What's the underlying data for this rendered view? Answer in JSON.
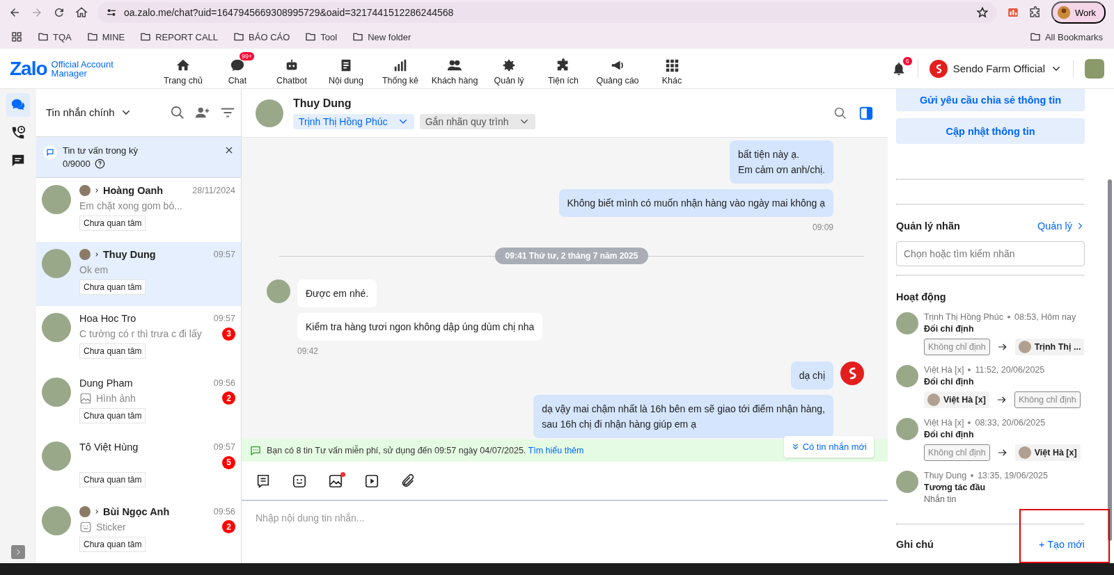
{
  "browser": {
    "url": "oa.zalo.me/chat?uid=1647945669308995729&oaid=3217441512286244568",
    "profile": "Work",
    "bookmarks": [
      "TQA",
      "MINE",
      "REPORT CALL",
      "BÁO CÁO",
      "Tool",
      "New folder"
    ],
    "all_bookmarks": "All Bookmarks"
  },
  "app": {
    "logo": "Zalo",
    "logo_sub": "Official Account Manager",
    "nav": [
      {
        "label": "Trang chủ"
      },
      {
        "label": "Chat",
        "badge": "99+"
      },
      {
        "label": "Chatbot"
      },
      {
        "label": "Nội dung"
      },
      {
        "label": "Thống kê"
      },
      {
        "label": "Khách hàng"
      },
      {
        "label": "Quản lý"
      },
      {
        "label": "Tiện ích"
      },
      {
        "label": "Quảng cáo"
      },
      {
        "label": "Khác"
      }
    ],
    "notifications": "6",
    "account": "Sendo Farm Official"
  },
  "rail": [
    {
      "selected": true
    },
    {
      "selected": false
    },
    {
      "selected": false
    }
  ],
  "list": {
    "filter": "Tin nhắn chính",
    "quota": {
      "title": "Tin tư vấn trong kỳ",
      "count": "0/9000"
    },
    "conversations": [
      {
        "kind": "text",
        "name": "Hoàng Oanh",
        "assigned": true,
        "time": "28/11/2024",
        "preview": "Em chặt xong gom bỏ...",
        "tag": "Chưa quan tâm",
        "selected": false
      },
      {
        "kind": "text",
        "name": "Thuy Dung",
        "assigned": true,
        "time": "09:57",
        "preview": "Ok em",
        "tag": "Chưa quan tâm",
        "selected": true
      },
      {
        "kind": "text",
        "name": "Hoa Hoc Tro",
        "assigned": false,
        "time": "09:57",
        "preview": "C tưởng có r thì trưa c đi lấy",
        "unread": "3",
        "tag": "Chưa quan tâm",
        "selected": false
      },
      {
        "kind": "image",
        "name": "Dung Pham",
        "assigned": false,
        "time": "09:56",
        "preview": "Hình ảnh",
        "unread": "2",
        "tag": "Chưa quan tâm",
        "selected": false
      },
      {
        "kind": "text",
        "name": "Tô Việt Hùng",
        "assigned": false,
        "time": "09:57",
        "unread": "5",
        "tag": "Chưa quan tâm",
        "selected": false
      },
      {
        "kind": "sticker",
        "name": "Bùi Ngọc Anh",
        "assigned": true,
        "time": "09:56",
        "preview": "Sticker",
        "unread": "2",
        "tag": "Chưa quan tâm",
        "selected": false
      }
    ]
  },
  "chat": {
    "name": "Thuy Dung",
    "assignee": "Trịnh Thị Hồng Phúc",
    "process_tag": "Gắn nhãn quy trình",
    "messages": [
      {
        "kind": "out",
        "lines": [
          "bất tiện này ạ.",
          "Em cảm ơn anh/chị."
        ],
        "avatar": false
      },
      {
        "kind": "out",
        "lines": [
          "Không biết mình có muốn nhận hàng vào ngày mai không ạ"
        ],
        "avatar": false
      },
      {
        "kind": "time_out",
        "text": "09:09"
      },
      {
        "kind": "divider",
        "text": "09:41 Thứ tư, 2 tháng 7 năm 2025"
      },
      {
        "kind": "in",
        "lines": [
          "Được em nhé."
        ],
        "avatar": true
      },
      {
        "kind": "in",
        "lines": [
          "Kiểm tra hàng tươi ngon không dập úng dùm chị nha"
        ],
        "avatar": false
      },
      {
        "kind": "time_in",
        "text": "09:42"
      },
      {
        "kind": "out",
        "lines": [
          "dạ chị"
        ],
        "avatar": true
      },
      {
        "kind": "out",
        "lines": [
          "dạ vậy mai chậm nhất là 16h bên em sẽ giao tới điểm nhận hàng,",
          "sau 16h chị đi nhận hàng giúp em ạ"
        ],
        "avatar": false
      }
    ],
    "new_messages": "Có tin nhắn mới",
    "notice": "Bạn có 8 tin Tư vấn miễn phí, sử dụng đến 09:57 ngày 04/07/2025.",
    "notice_link": "Tìm hiểu thêm",
    "input_placeholder": "Nhập nội dung tin nhắn..."
  },
  "panel": {
    "buttons": [
      "Gửi yêu cầu chia sẻ thông tin",
      "Cập nhật thông tin"
    ],
    "labels_title": "Quản lý nhãn",
    "labels_link": "Quản lý",
    "labels_placeholder": "Chọn hoặc tìm kiếm nhãn",
    "activity_title": "Hoạt động",
    "activities": [
      {
        "actor": "Trịnh Thị Hồng Phúc",
        "time": "08:53, Hôm nay",
        "action": "Đổi chỉ định",
        "from": {
          "kind": "none",
          "text": "Không chỉ định"
        },
        "to": {
          "kind": "person",
          "text": "Trịnh Thị ..."
        }
      },
      {
        "actor": "Việt Hà [x]",
        "time": "11:52, 20/06/2025",
        "action": "Đổi chỉ định",
        "from": {
          "kind": "person",
          "text": "Việt Hà  [x]"
        },
        "to": {
          "kind": "none",
          "text": "Không chỉ định"
        }
      },
      {
        "actor": "Việt Hà [x]",
        "time": "08:33, 20/06/2025",
        "action": "Đổi chỉ định",
        "from": {
          "kind": "none",
          "text": "Không chỉ định"
        },
        "to": {
          "kind": "person",
          "text": "Việt Hà  [x]"
        }
      },
      {
        "actor": "Thuy Dung",
        "time": "13:35, 19/06/2025",
        "action": "Tương tác đầu",
        "detail": "Nhắn tin"
      }
    ],
    "notes_title": "Ghi chú",
    "notes_link": "+ Tạo mới"
  }
}
